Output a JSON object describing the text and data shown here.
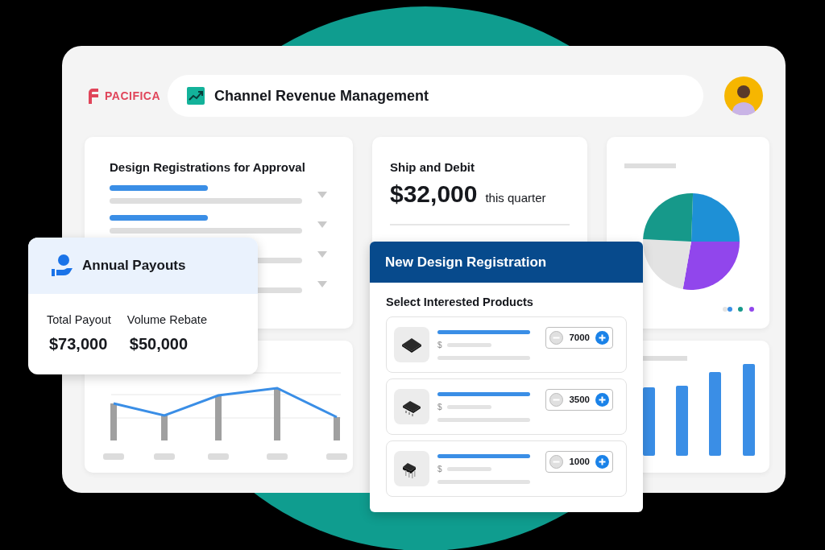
{
  "brand": {
    "name": "PACIFICA"
  },
  "app_title": "Channel Revenue Management",
  "approvals_card": {
    "title": "Design Registrations for Approval"
  },
  "ship_debit_card": {
    "title": "Ship and Debit",
    "amount": "$32,000",
    "period": "this quarter"
  },
  "payouts_card": {
    "title": "Annual Payouts",
    "metrics": [
      {
        "label": "Total Payout",
        "value": "$73,000"
      },
      {
        "label": "Volume Rebate",
        "value": "$50,000"
      }
    ]
  },
  "registration_dialog": {
    "title": "New Design Registration",
    "section": "Select Interested Products",
    "products": [
      {
        "kind": "flat",
        "price_symbol": "$",
        "quantity": "7000"
      },
      {
        "kind": "gullwing",
        "price_symbol": "$",
        "quantity": "3500"
      },
      {
        "kind": "dip",
        "price_symbol": "$",
        "quantity": "1000"
      }
    ]
  }
}
